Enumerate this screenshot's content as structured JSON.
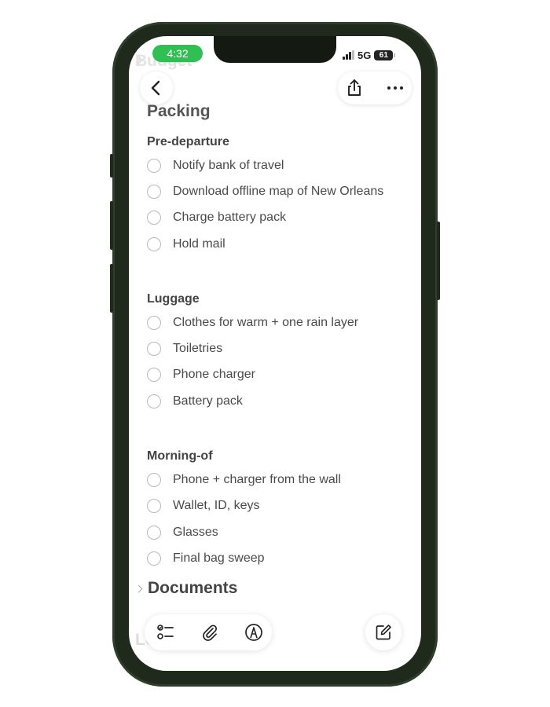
{
  "status_bar": {
    "time": "4:32",
    "network": "5G",
    "battery": "61"
  },
  "background_ghost": {
    "top_section": "Budget",
    "bottom_section": "Logbook Ib"
  },
  "note": {
    "title": "Packing",
    "sections": [
      {
        "heading": "Pre-departure",
        "items": [
          {
            "text": "Notify bank of travel",
            "checked": false
          },
          {
            "text": "Download offline map of New Orleans",
            "checked": false
          },
          {
            "text": "Charge battery pack",
            "checked": false
          },
          {
            "text": "Hold mail",
            "checked": false
          }
        ]
      },
      {
        "heading": "Luggage",
        "items": [
          {
            "text": "Clothes for warm + one rain layer",
            "checked": false
          },
          {
            "text": "Toiletries",
            "checked": false
          },
          {
            "text": "Phone charger",
            "checked": false
          },
          {
            "text": "Battery pack",
            "checked": false
          }
        ]
      },
      {
        "heading": "Morning-of",
        "items": [
          {
            "text": "Phone + charger from the wall",
            "checked": false
          },
          {
            "text": "Wallet, ID, keys",
            "checked": false
          },
          {
            "text": "Glasses",
            "checked": false
          },
          {
            "text": "Final bag sweep",
            "checked": false
          }
        ]
      }
    ],
    "collapsed_section": "Documents"
  },
  "top_actions": {
    "back": "back-icon",
    "share": "share-icon",
    "more": "more-icon"
  },
  "toolbar": {
    "checklist": "checklist-icon",
    "attach": "paperclip-icon",
    "markup": "markup-pen-icon",
    "compose": "compose-icon"
  },
  "colors": {
    "status_pill": "#2fbf52",
    "phone_frame": "#1f2a1d"
  }
}
